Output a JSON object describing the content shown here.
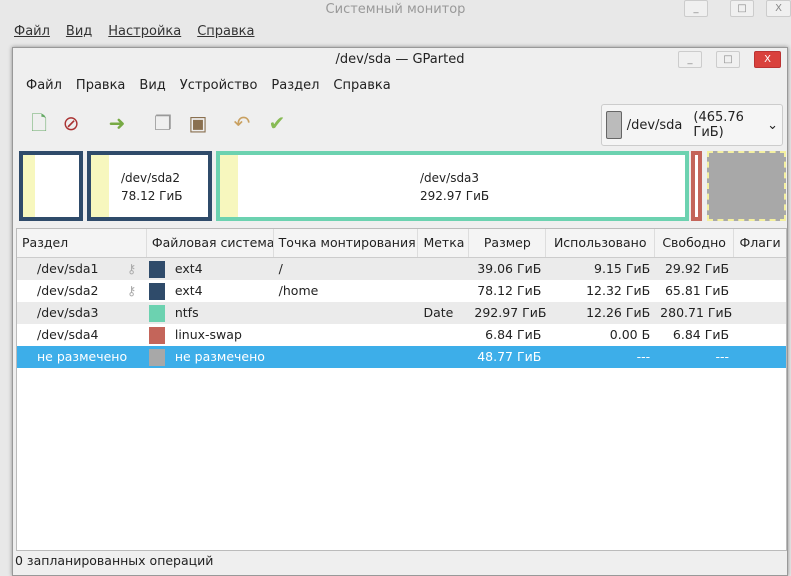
{
  "background_window": {
    "title": "Системный монитор",
    "menu": [
      "Файл",
      "Вид",
      "Настройка",
      "Справка"
    ]
  },
  "window": {
    "title": "/dev/sda — GParted"
  },
  "menu": [
    "Файл",
    "Правка",
    "Вид",
    "Устройство",
    "Раздел",
    "Справка"
  ],
  "toolbar": [
    "new-icon",
    "delete-icon",
    "resize-icon",
    "copy-icon",
    "paste-icon",
    "undo-icon",
    "apply-icon"
  ],
  "device_selector": {
    "device": "/dev/sda",
    "size": "(465.76 ГиБ)"
  },
  "colors": {
    "ext4": "#2f4b6a",
    "ntfs": "#6cd2b0",
    "linux-swap": "#c4655a",
    "unallocated": "#a8a8a8",
    "selection": "#3daee9"
  },
  "disk_map": [
    {
      "name": "/dev/sda1",
      "size": ""
    },
    {
      "name": "/dev/sda2",
      "size": "78.12 ГиБ"
    },
    {
      "name": "/dev/sda3",
      "size": "292.97 ГиБ"
    },
    {
      "name": "/dev/sda4",
      "size": ""
    },
    {
      "name": "unallocated",
      "size": ""
    }
  ],
  "table": {
    "headers": [
      "Раздел",
      "Файловая система",
      "Точка монтирования",
      "Метка",
      "Размер",
      "Использовано",
      "Свободно",
      "Флаги"
    ],
    "rows": [
      {
        "partition": "/dev/sda1",
        "fs": "ext4",
        "mount": "/",
        "label": "",
        "size": "39.06 ГиБ",
        "used": "9.15 ГиБ",
        "free": "29.92 ГиБ",
        "flags": ""
      },
      {
        "partition": "/dev/sda2",
        "fs": "ext4",
        "mount": "/home",
        "label": "",
        "size": "78.12 ГиБ",
        "used": "12.32 ГиБ",
        "free": "65.81 ГиБ",
        "flags": ""
      },
      {
        "partition": "/dev/sda3",
        "fs": "ntfs",
        "mount": "",
        "label": "Date",
        "size": "292.97 ГиБ",
        "used": "12.26 ГиБ",
        "free": "280.71 ГиБ",
        "flags": ""
      },
      {
        "partition": "/dev/sda4",
        "fs": "linux-swap",
        "mount": "",
        "label": "",
        "size": "6.84 ГиБ",
        "used": "0.00 Б",
        "free": "6.84 ГиБ",
        "flags": ""
      },
      {
        "partition": "не размечено",
        "fs": "не размечено",
        "mount": "",
        "label": "",
        "size": "48.77 ГиБ",
        "used": "---",
        "free": "---",
        "flags": ""
      }
    ]
  },
  "status": "0 запланированных операций"
}
